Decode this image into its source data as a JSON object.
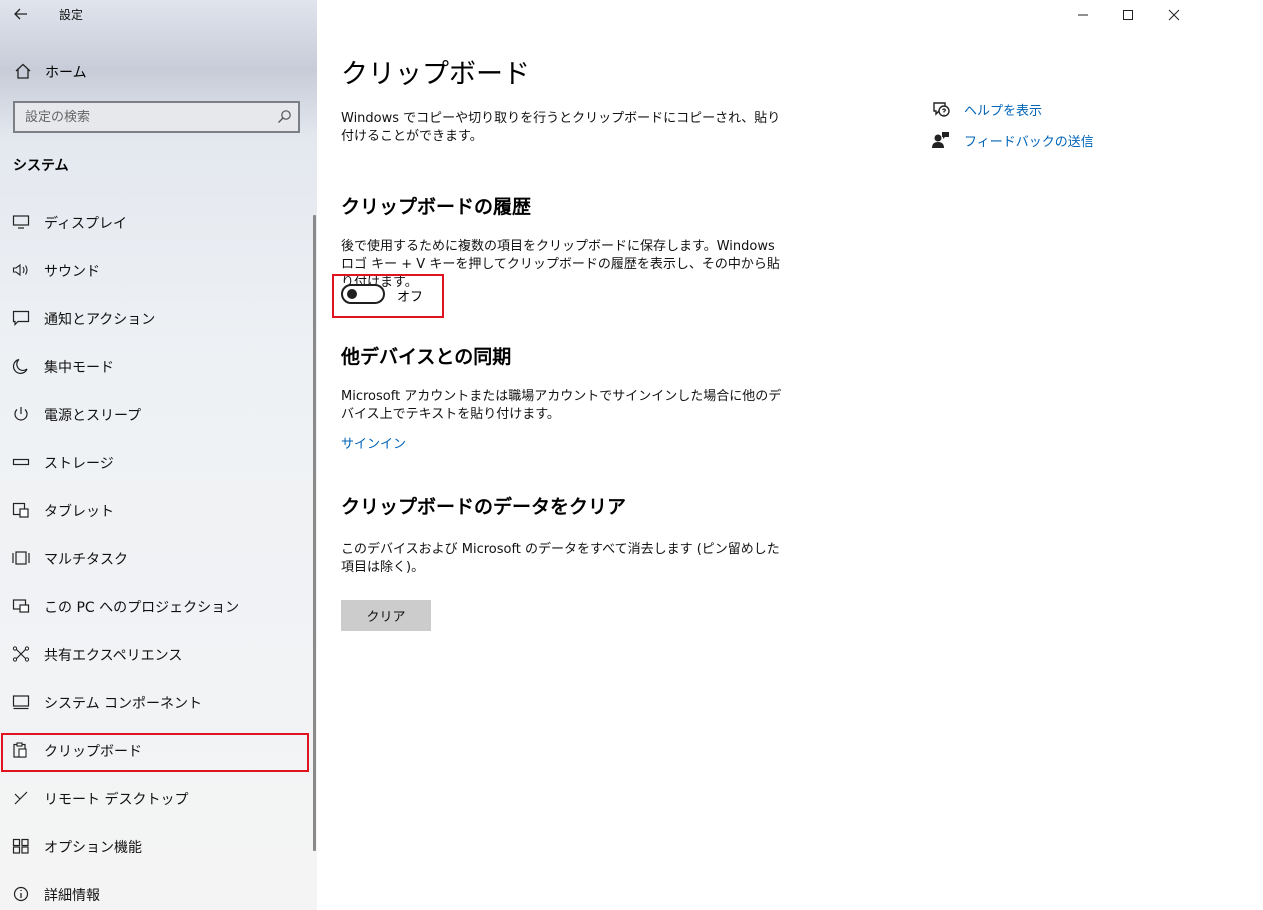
{
  "app": {
    "title": "設定"
  },
  "sidebar": {
    "home_label": "ホーム",
    "search_placeholder": "設定の検索",
    "section_title": "システム",
    "items": [
      {
        "label": "ディスプレイ",
        "icon": "monitor-icon"
      },
      {
        "label": "サウンド",
        "icon": "speaker-icon"
      },
      {
        "label": "通知とアクション",
        "icon": "notification-icon"
      },
      {
        "label": "集中モード",
        "icon": "moon-icon"
      },
      {
        "label": "電源とスリープ",
        "icon": "power-icon"
      },
      {
        "label": "ストレージ",
        "icon": "storage-icon"
      },
      {
        "label": "タブレット",
        "icon": "tablet-icon"
      },
      {
        "label": "マルチタスク",
        "icon": "multitask-icon"
      },
      {
        "label": "この PC へのプロジェクション",
        "icon": "projection-icon"
      },
      {
        "label": "共有エクスペリエンス",
        "icon": "shared-icon"
      },
      {
        "label": "システム コンポーネント",
        "icon": "components-icon"
      },
      {
        "label": "クリップボード",
        "icon": "clipboard-icon",
        "selected": true
      },
      {
        "label": "リモート デスクトップ",
        "icon": "remote-icon"
      },
      {
        "label": "オプション機能",
        "icon": "optional-features-icon"
      },
      {
        "label": "詳細情報",
        "icon": "info-icon"
      }
    ]
  },
  "main": {
    "title": "クリップボード",
    "intro": "Windows でコピーや切り取りを行うとクリップボードにコピーされ、貼り付けることができます。",
    "history": {
      "heading": "クリップボードの履歴",
      "description": "後で使用するために複数の項目をクリップボードに保存します。Windows ロゴ キー + V キーを押してクリップボードの履歴を表示し、その中から貼り付けます。",
      "toggle_state": "オフ",
      "toggle_on": false
    },
    "sync": {
      "heading": "他デバイスとの同期",
      "description": "Microsoft アカウントまたは職場アカウントでサインインした場合に他のデバイス上でテキストを貼り付けます。",
      "signin_link": "サインイン"
    },
    "clear": {
      "heading": "クリップボードのデータをクリア",
      "description": "このデバイスおよび Microsoft のデータをすべて消去します (ピン留めした項目は除く)。",
      "button_label": "クリア"
    }
  },
  "related": {
    "help_label": "ヘルプを表示",
    "feedback_label": "フィードバックの送信"
  },
  "colors": {
    "accent_link": "#0064b8",
    "highlight_border": "#e0141e"
  }
}
